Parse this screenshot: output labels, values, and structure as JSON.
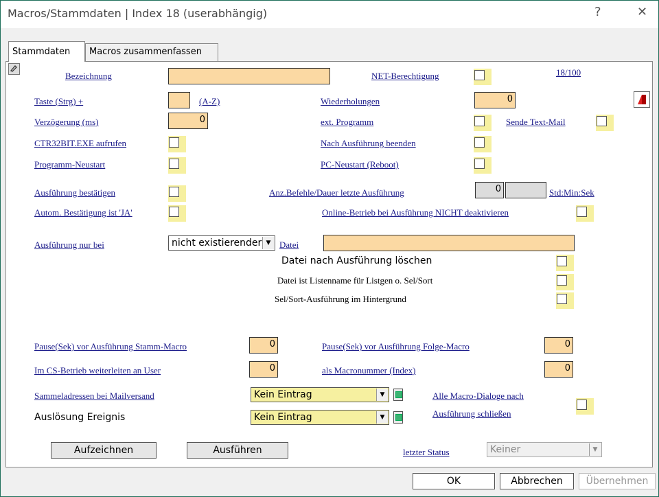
{
  "window": {
    "title": "Macros/Stammdaten | Index 18 (userabhängig)",
    "help": "?",
    "close": "✕"
  },
  "tabs": [
    {
      "label": "Stammdaten"
    },
    {
      "label": "Macros zusammenfassen"
    }
  ],
  "counter": "18/100",
  "labels": {
    "bezeichnung": "Bezeichnung",
    "net": "NET-Berechtigung",
    "taste": "Taste (Strg) +",
    "az": "(A-Z)",
    "wiederholungen": "Wiederholungen",
    "verzoegerung": "Verzögerung (ms)",
    "ext": "ext. Programm",
    "sende": "Sende Text-Mail",
    "ctr": "CTR32BIT.EXE aufrufen",
    "nach": "Nach Ausführung beenden",
    "neustart": "Programm-Neustart",
    "reboot": "PC-Neustart (Reboot)",
    "bestaetigen": "Ausführung bestätigen",
    "anz": "Anz.Befehle/Dauer letzte Ausführung",
    "std": "Std:Min:Sek",
    "autom": "Autom. Bestätigung ist 'JA'",
    "online": "Online-Betrieb bei Ausführung NICHT deaktivieren",
    "nurbei": "Ausführung nur bei",
    "datei": "Datei",
    "loeschen": "Datei nach Ausführung löschen",
    "listen": "Datei ist Listenname für Listgen o. Sel/Sort",
    "hintergrund": "Sel/Sort-Ausführung im Hintergrund",
    "pause_stamm": "Pause(Sek) vor Ausführung Stamm-Macro",
    "pause_folge": "Pause(Sek) vor Ausführung Folge-Macro",
    "cs": "Im CS-Betrieb weiterleiten an User",
    "macronr": "als Macronummer (Index)",
    "sammel": "Sammeladressen bei Mailversand",
    "ausloesung": "Auslösung Ereignis",
    "alle1": "Alle Macro-Dialoge nach",
    "alle2": "Ausführung schließen",
    "status": "letzter Status"
  },
  "values": {
    "wiederholungen": "0",
    "verzoegerung": "0",
    "anz_befehle": "0",
    "nurbei_select": "nicht existierender",
    "pause_stamm": "0",
    "pause_folge": "0",
    "cs": "0",
    "macronr": "0",
    "sammel_select": "Kein Eintrag",
    "ausloesung_select": "Kein Eintrag",
    "status_select": "Keiner"
  },
  "buttons": {
    "aufzeichnen": "Aufzeichnen",
    "ausfuehren": "Ausführen",
    "ok": "OK",
    "abbrechen": "Abbrechen",
    "uebernehmen": "Übernehmen"
  },
  "colors": {
    "field": "#fbd9a3",
    "check_bg": "#f6f0a0",
    "link": "#1a1a8a"
  }
}
